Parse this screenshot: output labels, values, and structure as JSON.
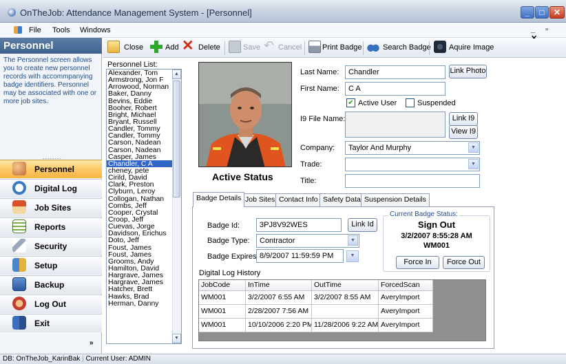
{
  "window": {
    "title": "OnTheJob: Attendance Management System - [Personnel]"
  },
  "menu": {
    "file": "File",
    "tools": "Tools",
    "windows": "Windows",
    "mdi_controls": "_ ▫ ✕"
  },
  "sidebar": {
    "header": "Personnel",
    "description": "The Personnel screen allows you to create new personnel records with accommpanying badge identifiers. Personnel may be associated with one or more job sites.",
    "grip": "........",
    "items": [
      {
        "label": "Personnel"
      },
      {
        "label": "Digital Log"
      },
      {
        "label": "Job Sites"
      },
      {
        "label": "Reports"
      },
      {
        "label": "Security"
      },
      {
        "label": "Setup"
      },
      {
        "label": "Backup"
      },
      {
        "label": "Log Out"
      },
      {
        "label": "Exit"
      }
    ],
    "more": "»"
  },
  "toolbar": {
    "close": "Close",
    "add": "Add",
    "delete": "Delete",
    "save": "Save",
    "cancel": "Cancel",
    "print_badge": "Print Badge",
    "search_badge": "Search Badge",
    "acquire_image": "Aquire Image"
  },
  "personnel_list": {
    "label": "Personnel List:",
    "selected": "Chandler, C A",
    "items": [
      "Alexander, Tom",
      "Armstrong, Jon F",
      "Arrowood, Norman",
      "Baker, Danny",
      "Bevins, Eddie",
      "Booher, Robert",
      "Bright, Michael",
      "Bryant, Russell",
      "Candler, Tommy",
      "Candler, Tommy",
      "Carson, Nadean",
      "Carson, Nadean",
      "Casper, James",
      "Chandler, C A",
      "cheney, pete",
      "Cirild, David",
      "Clark, Preston",
      "Clyburn, Leroy",
      "Collogan, Nathan",
      "Combs, Jeff",
      "Cooper, Crystal",
      "Croop, Jeff",
      "Cuevas, Jorge",
      "Davidson, Erichus",
      "Doto, Jeff",
      "Foust, James",
      "Foust, James",
      "Grooms, Andy",
      "Hamilton, David",
      "Hargrave, James",
      "Hargrave, James",
      "Hatcher, Brett",
      "Hawks, Brad",
      "Herman, Danny"
    ]
  },
  "status_label": "Active Status",
  "form": {
    "last_name_label": "Last Name:",
    "last_name": "Chandler",
    "first_name_label": "First Name:",
    "first_name": "C A",
    "active_user": "Active User",
    "suspended": "Suspended",
    "i9_label": "I9 File Name:",
    "i9_value": "",
    "company_label": "Company:",
    "company": "Taylor And Murphy",
    "trade_label": "Trade:",
    "trade": "",
    "title_label": "Title:",
    "title": "",
    "link_photo": "Link Photo",
    "link_i9": "Link I9",
    "view_i9": "View I9"
  },
  "tabs": [
    "Badge Details",
    "Job Sites",
    "Contact Info",
    "Safety Data",
    "Suspension Details"
  ],
  "badge": {
    "id_label": "Badge Id:",
    "id": "3PJ8V92WES",
    "link_id": "Link Id",
    "type_label": "Badge Type:",
    "type": "Contractor",
    "expires_label": "Badge Expires:",
    "expires": "8/9/2007 11:59:59 PM",
    "status_title": "Current Badge Status:",
    "status": "Sign Out",
    "status_time": "3/2/2007 8:55:28 AM",
    "status_code": "WM001",
    "force_in": "Force In",
    "force_out": "Force Out"
  },
  "log": {
    "label": "Digital Log History",
    "columns": [
      "JobCode",
      "InTime",
      "OutTime",
      "ForcedScan"
    ],
    "rows": [
      [
        "WM001",
        "3/2/2007 6:55 AM",
        "3/2/2007 8:55 AM",
        "AveryImport"
      ],
      [
        "WM001",
        "2/28/2007 7:56 AM",
        "",
        "AveryImport"
      ],
      [
        "WM001",
        "10/10/2006 2:20 PM",
        "11/28/2006 9:22 AM",
        "AveryImport"
      ]
    ]
  },
  "statusbar": {
    "db": "DB: OnTheJob_KarinBak",
    "user": "Current User: ADMIN"
  }
}
